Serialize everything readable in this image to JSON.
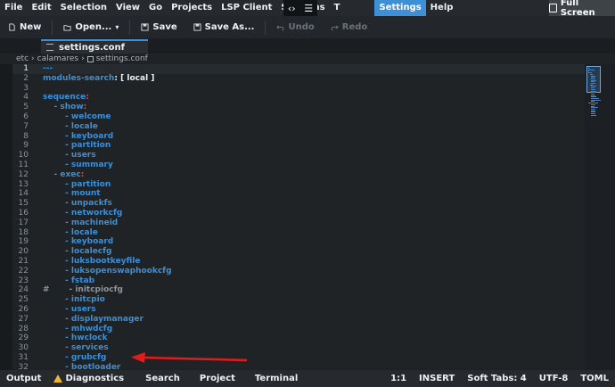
{
  "menubar": {
    "items": [
      "File",
      "Edit",
      "Selection",
      "View",
      "Go",
      "Projects",
      "LSP Client",
      "Sessions",
      "T",
      "Settings",
      "Help"
    ],
    "highlighted": "Settings",
    "overlay_icons": [
      "code-icon",
      "hamburger-menu-icon"
    ],
    "fullscreen_label": "Full Screen"
  },
  "toolbar": {
    "new_label": "New",
    "open_label": "Open...",
    "save_label": "Save",
    "save_as_label": "Save As...",
    "undo_label": "Undo",
    "redo_label": "Redo"
  },
  "tabs": [
    {
      "label": "settings.conf",
      "active": true
    }
  ],
  "breadcrumb": [
    "etc",
    "calamares",
    "settings.conf"
  ],
  "editor": {
    "current_line": 1,
    "lines": [
      {
        "num": "1",
        "text": "---"
      },
      {
        "num": "2",
        "text": "modules-search",
        "suffix": ": [ local ]",
        "marker": true
      },
      {
        "num": "3",
        "text": ""
      },
      {
        "num": "4",
        "text": "sequence",
        "marker_colon": true
      },
      {
        "num": "5",
        "text": "    - show",
        "marker_colon": true
      },
      {
        "num": "6",
        "text": "        - welcome"
      },
      {
        "num": "7",
        "text": "        - locale"
      },
      {
        "num": "8",
        "text": "        - keyboard"
      },
      {
        "num": "9",
        "text": "        - partition"
      },
      {
        "num": "10",
        "text": "        - users"
      },
      {
        "num": "11",
        "text": "        - summary"
      },
      {
        "num": "12",
        "text": "    - exec",
        "marker_colon": true
      },
      {
        "num": "13",
        "text": "        - partition"
      },
      {
        "num": "14",
        "text": "        - mount"
      },
      {
        "num": "15",
        "text": "        - unpackfs"
      },
      {
        "num": "16",
        "text": "        - networkcfg"
      },
      {
        "num": "17",
        "text": "        - machineid"
      },
      {
        "num": "18",
        "text": "        - locale"
      },
      {
        "num": "19",
        "text": "        - keyboard"
      },
      {
        "num": "20",
        "text": "        - localecfg"
      },
      {
        "num": "21",
        "text": "        - luksbootkeyfile"
      },
      {
        "num": "22",
        "text": "        - luksopenswaphookcfg"
      },
      {
        "num": "23",
        "text": "        - fstab"
      },
      {
        "num": "24",
        "text": "#       - initcpiocfg",
        "comment": true
      },
      {
        "num": "25",
        "text": "        - initcpio"
      },
      {
        "num": "26",
        "text": "        - users"
      },
      {
        "num": "27",
        "text": "        - displaymanager"
      },
      {
        "num": "28",
        "text": "        - mhwdcfg"
      },
      {
        "num": "29",
        "text": "        - hwclock"
      },
      {
        "num": "30",
        "text": "        - services"
      },
      {
        "num": "31",
        "text": "        - grubcfg"
      },
      {
        "num": "32",
        "text": "        - bootloader"
      }
    ]
  },
  "statusbar": {
    "output_label": "Output",
    "diagnostics_label": "Diagnostics",
    "search_label": "Search",
    "project_label": "Project",
    "terminal_label": "Terminal",
    "cursor_pos": "1:1",
    "mode": "INSERT",
    "indent": "Soft Tabs: 4",
    "encoding": "UTF-8",
    "language": "TOML"
  },
  "colors": {
    "accent": "#3d8fd6",
    "arrow": "#e31b1b",
    "warning": "#f2b531"
  }
}
